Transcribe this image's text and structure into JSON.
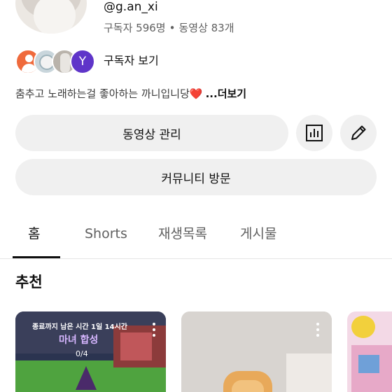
{
  "channel": {
    "handle": "@g.an_xi",
    "subscriber_count": "구독자 596명",
    "separator": "•",
    "video_count": "동영상 83개",
    "subscribers_link": "구독자 보기",
    "subscriber_avatar_letter": "Y",
    "description": "춤추고 노래하는걸 좋아하는 까니입니당",
    "description_heart": "❤️",
    "more_label": "...더보기"
  },
  "buttons": {
    "manage_videos": "동영상 관리",
    "visit_community": "커뮤니티 방문"
  },
  "tabs": {
    "home": "홈",
    "shorts": "Shorts",
    "playlists": "재생목록",
    "posts": "게시물"
  },
  "section": {
    "title": "추천"
  },
  "videos": [
    {
      "caption": "종료까지 남은 시간 1일 14시간",
      "title": "마녀 합성",
      "counter": "0/4"
    }
  ],
  "icons": {
    "analytics": "bar-chart-icon",
    "edit": "pencil-icon",
    "more": "kebab-menu-icon"
  },
  "colors": {
    "button_bg": "#f0f0f0",
    "text_secondary": "#606060",
    "avatar_y": "#5f35c9",
    "avatar_orange": "#ef6a3c"
  }
}
